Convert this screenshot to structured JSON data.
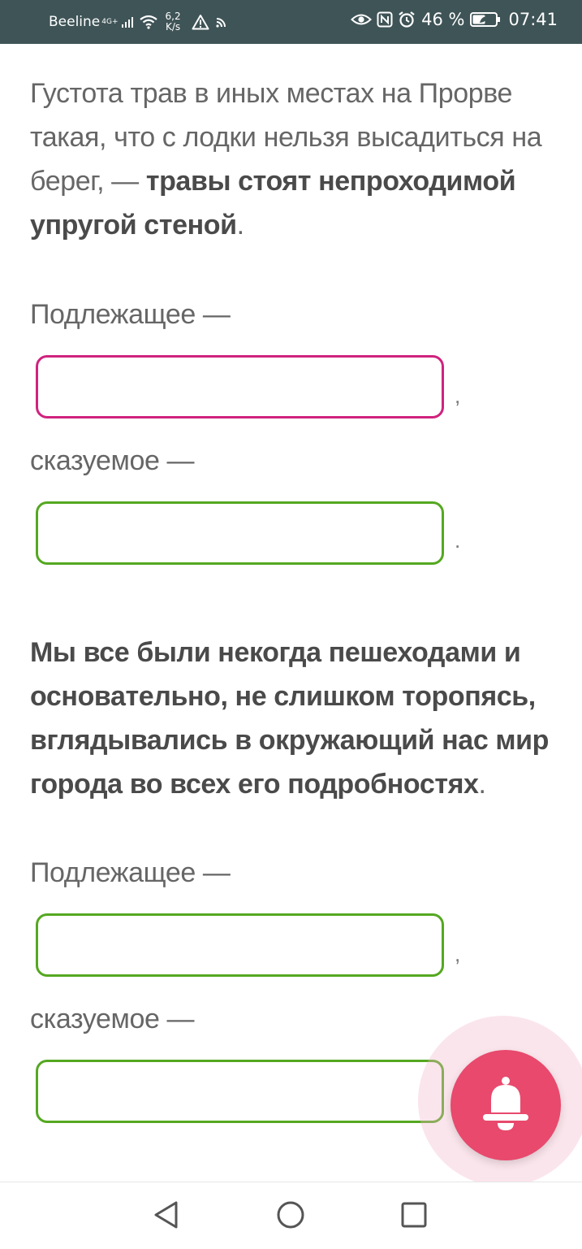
{
  "status_bar": {
    "carrier": "Beeline",
    "network_type": "4G+",
    "speed_value": "6,2",
    "speed_unit": "K/s",
    "battery_percent": "46 %",
    "time": "07:41",
    "icons": [
      "signal-icon",
      "wifi-icon",
      "warning-icon",
      "cast-icon",
      "eye-icon",
      "nfc-icon",
      "alarm-icon",
      "battery-icon"
    ]
  },
  "exercise1": {
    "sentence_plain": "Густота трав в иных местах на Прорве такая, что с лодки нельзя высадиться на берег, — ",
    "sentence_bold": "травы стоят непроходимой упругой стеной",
    "sentence_end": ".",
    "subject_label": "Подлежащее —",
    "subject_value": "",
    "subject_punct": ",",
    "predicate_label": "сказуемое —",
    "predicate_value": "",
    "predicate_punct": "."
  },
  "exercise2": {
    "sentence_bold": "Мы все были некогда пешеходами и основательно, не слишком торопясь, вглядывались в окружающий нас мир города во всех его подробностях",
    "sentence_end": ".",
    "subject_label": "Подлежащее —",
    "subject_value": "",
    "subject_punct": ",",
    "predicate_label": "сказуемое —",
    "predicate_value": ""
  },
  "colors": {
    "status_bar_bg": "#3f5457",
    "field_pink": "#d0237e",
    "field_green": "#55a821",
    "bell_button": "#e8496d"
  },
  "fab": {
    "icon": "bell-icon"
  },
  "nav_bar": {
    "icons": [
      "back-icon",
      "home-icon",
      "recents-icon"
    ]
  }
}
